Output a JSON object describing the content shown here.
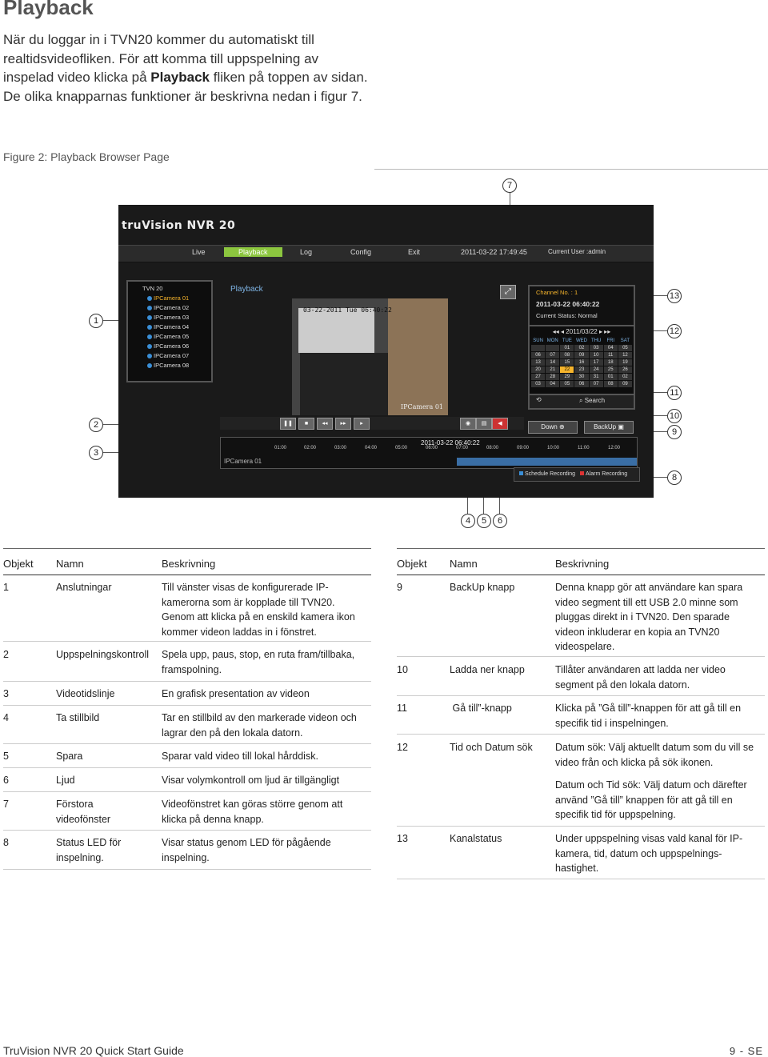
{
  "page": {
    "title": "Playback",
    "intro_1": "När du loggar in i TVN20 kommer du automatiskt till realtidsvideofliken. För att komma till uppspelning av inspelad video klicka på ",
    "intro_bold": "Playback",
    "intro_2": " fliken på toppen av sidan. De olika knapparnas funktioner är beskrivna nedan i figur 7.",
    "figure_caption": "Figure 2: Playback Browser Page"
  },
  "callouts": [
    "7",
    "1",
    "13",
    "12",
    "11",
    "2",
    "10",
    "9",
    "3",
    "8",
    "4",
    "5",
    "6"
  ],
  "screenshot": {
    "logo": "truVision NVR 20",
    "nav": [
      "Live",
      "Playback",
      "Log",
      "Config",
      "Exit"
    ],
    "datetime": "2011-03-22 17:49:45",
    "user": "Current User :admin",
    "panel_title": "Playback",
    "tree_root": "TVN 20",
    "cameras": [
      "IPCamera 01",
      "IPCamera 02",
      "IPCamera 03",
      "IPCamera 04",
      "IPCamera 05",
      "IPCamera 06",
      "IPCamera 07",
      "IPCamera 08"
    ],
    "video_timestamp": "03-22-2011 Tue 06:40:22",
    "video_camera": "IPCamera 01",
    "status_channel": "Channel No. : 1",
    "status_date": "2011-03-22 06:40:22",
    "status_text": "Current Status: Normal",
    "calendar_month": "2011/03/22",
    "weekdays": [
      "SUN",
      "MON",
      "TUE",
      "WED",
      "THU",
      "FRI",
      "SAT"
    ],
    "days": [
      "",
      "",
      "01",
      "02",
      "03",
      "04",
      "05",
      "06",
      "07",
      "08",
      "09",
      "10",
      "11",
      "12",
      "13",
      "14",
      "15",
      "16",
      "17",
      "18",
      "19",
      "20",
      "21",
      "22",
      "23",
      "24",
      "25",
      "26",
      "27",
      "28",
      "29",
      "30",
      "31",
      "01",
      "02",
      "03",
      "04",
      "05",
      "06",
      "07",
      "08",
      "09"
    ],
    "search_label": "Search",
    "down_label": "Down",
    "backup_label": "BackUp",
    "timeline_current": "2011-03-22 06:40:22",
    "timeline_camera": "IPCamera 01",
    "hours": [
      "01:00",
      "02:00",
      "03:00",
      "04:00",
      "05:00",
      "06:00",
      "07:00",
      "08:00",
      "09:00",
      "10:00",
      "11:00",
      "12:00"
    ],
    "legend_schedule": "Schedule Recording",
    "legend_alarm": "Alarm Recording"
  },
  "table_left": {
    "headers": [
      "Objekt",
      "Namn",
      "Beskrivning"
    ],
    "rows": [
      {
        "obj": "1",
        "name": "Anslutningar",
        "desc": "Till vänster visas de konfigurerade IP-kamerorna som är kopplade till TVN20. Genom att klicka på en enskild kamera ikon kommer videon laddas in i fönstret."
      },
      {
        "obj": "2",
        "name": "Uppspelningskontroll",
        "desc": "Spela upp, paus, stop, en ruta fram/tillbaka, framspolning."
      },
      {
        "obj": "3",
        "name": "Videotidslinje",
        "desc": "En grafisk presentation av videon"
      },
      {
        "obj": "4",
        "name": "Ta stillbild",
        "desc": "Tar en stillbild av den markerade videon och lagrar den på den lokala datorn."
      },
      {
        "obj": "5",
        "name": "Spara",
        "desc": "Sparar vald video till lokal hårddisk."
      },
      {
        "obj": "6",
        "name": "Ljud",
        "desc": "Visar volymkontroll om ljud är tillgängligt"
      },
      {
        "obj": "7",
        "name": "Förstora videofönster",
        "desc": "Videofönstret kan göras större genom att klicka på denna knapp."
      },
      {
        "obj": "8",
        "name": "Status LED för inspelning.",
        "desc": "Visar status genom LED för pågående inspelning."
      }
    ]
  },
  "table_right": {
    "headers": [
      "Objekt",
      "Namn",
      "Beskrivning"
    ],
    "rows": [
      {
        "obj": "9",
        "name": "BackUp knapp",
        "desc": "Denna knapp gör att användare kan spara video segment till ett USB 2.0 minne som pluggas direkt in i TVN20. Den sparade videon inkluderar en kopia an TVN20 videospelare."
      },
      {
        "obj": "10",
        "name": "Ladda ner knapp",
        "desc": "Tillåter användaren att ladda ner video segment på den lokala datorn."
      },
      {
        "obj": "11",
        "name": " Gå till”-knapp",
        "desc": "Klicka på ”Gå till”-knappen för att gå till en specifik tid i inspelningen."
      },
      {
        "obj": "12",
        "name": "Tid och Datum sök",
        "desc": "Datum sök: Välj aktuellt datum som du vill se video från och klicka på sök ikonen.",
        "desc2": "Datum och Tid sök: Välj datum och därefter använd ”Gå till” knappen för att gå till en specifik tid för uppspelning."
      },
      {
        "obj": "13",
        "name": "Kanalstatus",
        "desc": "Under uppspelning visas vald kanal för IP-kamera, tid, datum och uppspelnings-hastighet."
      }
    ]
  },
  "footer": {
    "left": "TruVision NVR 20 Quick Start Guide",
    "right": "9 - SE"
  },
  "colors": {
    "accent": "#8cc63f",
    "camera_blue": "#3a8ed6",
    "selected": "#f7b52c"
  }
}
